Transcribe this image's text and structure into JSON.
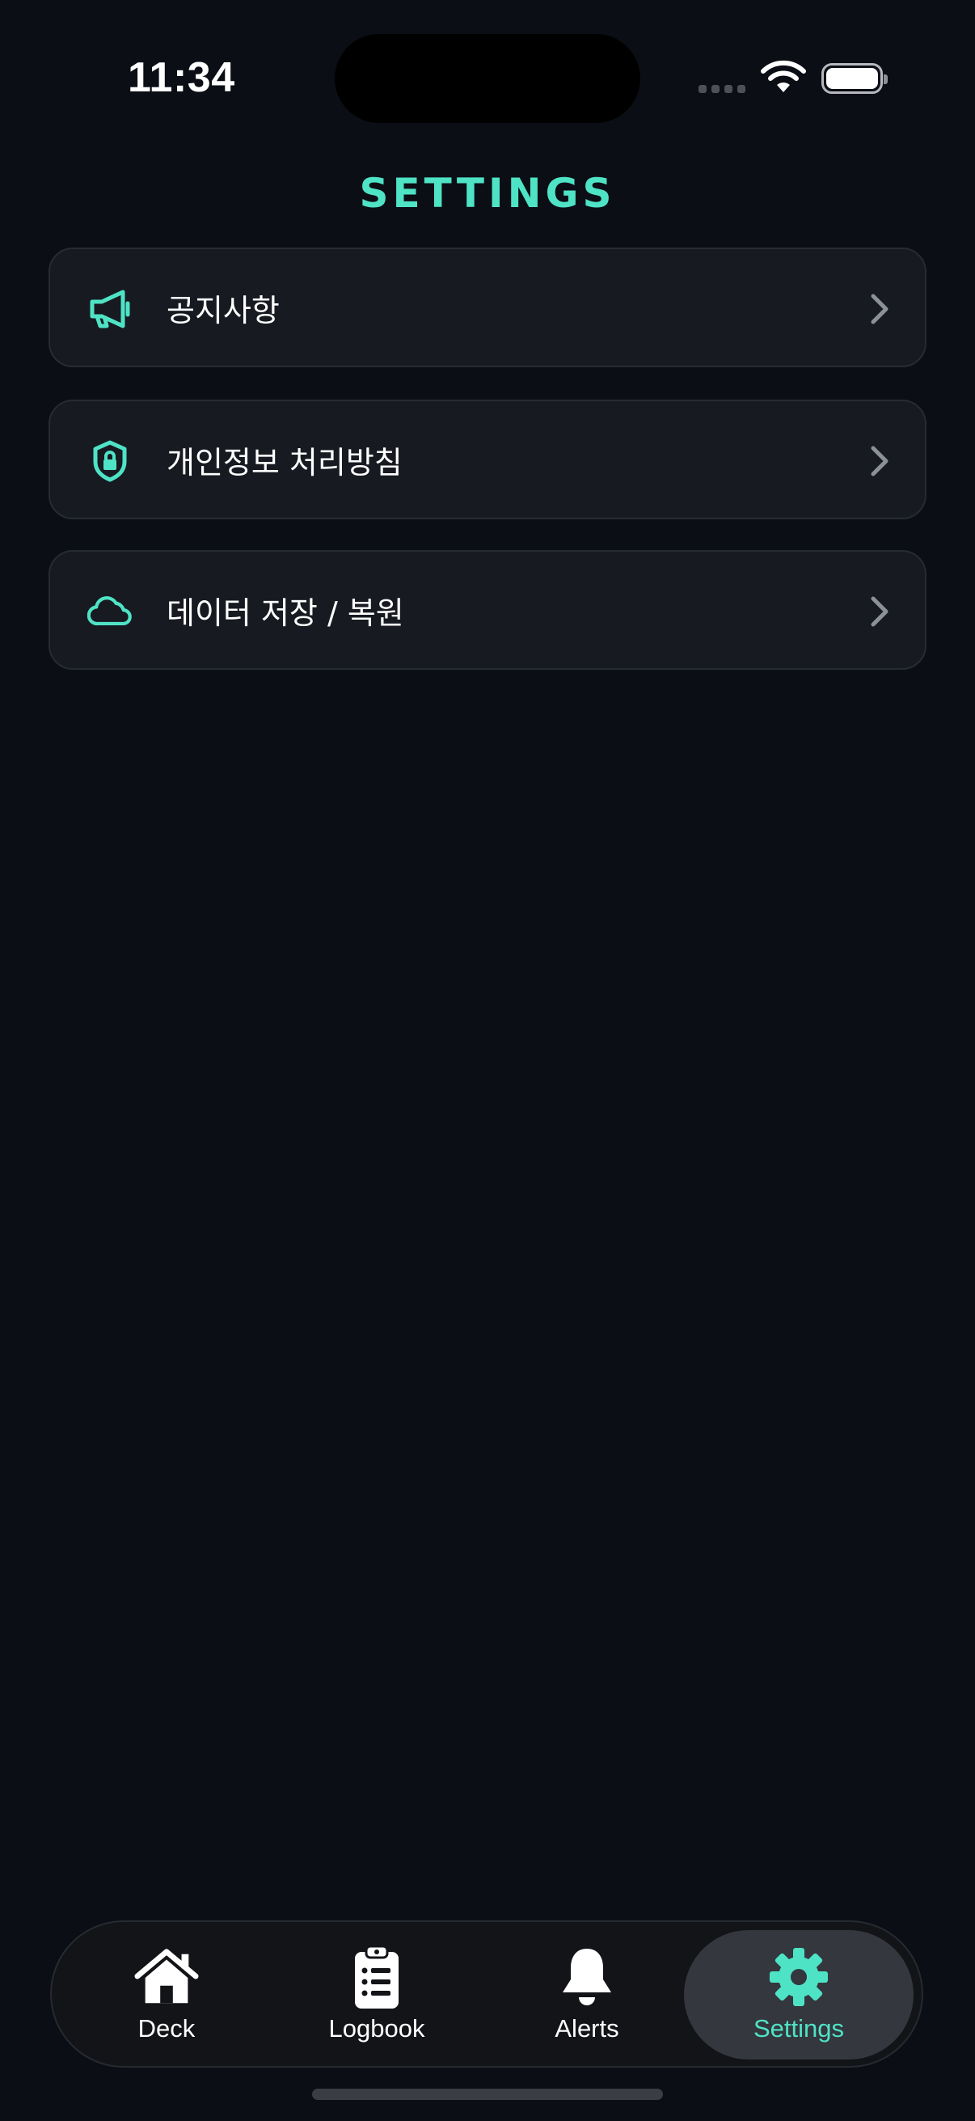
{
  "status_bar": {
    "time": "11:34"
  },
  "header": {
    "title": "SETTINGS"
  },
  "accent_color": "#4fe3c6",
  "menu": [
    {
      "label": "공지사항",
      "icon": "megaphone-icon"
    },
    {
      "label": "개인정보 처리방침",
      "icon": "shield-lock-icon"
    },
    {
      "label": "데이터 저장 / 복원",
      "icon": "cloud-icon"
    }
  ],
  "tabs": [
    {
      "label": "Deck",
      "icon": "home-icon",
      "active": false
    },
    {
      "label": "Logbook",
      "icon": "clipboard-list-icon",
      "active": false
    },
    {
      "label": "Alerts",
      "icon": "bell-icon",
      "active": false
    },
    {
      "label": "Settings",
      "icon": "gear-icon",
      "active": true
    }
  ]
}
